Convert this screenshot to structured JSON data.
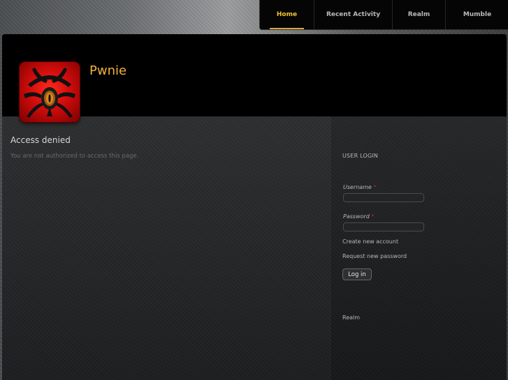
{
  "nav": {
    "items": [
      {
        "label": "Home",
        "active": true
      },
      {
        "label": "Recent Activity",
        "active": false
      },
      {
        "label": "Realm",
        "active": false
      },
      {
        "label": "Mumble",
        "active": false
      }
    ]
  },
  "header": {
    "site_name": "Pwnie",
    "logo_icon": "spider-emblem-icon"
  },
  "main": {
    "title": "Access denied",
    "message": "You are not authorized to access this page."
  },
  "sidebar": {
    "login_block": {
      "title": "USER LOGIN",
      "username_label": "Username",
      "password_label": "Password",
      "required_mark": "*",
      "username_value": "",
      "password_value": "",
      "create_account": "Create new account",
      "request_password": "Request new password",
      "login_button": "Log in"
    },
    "realm_link": "Realm"
  },
  "colors": {
    "accent": "#f2b23a",
    "required": "#d02020",
    "logo_red": "#d00c0c"
  }
}
